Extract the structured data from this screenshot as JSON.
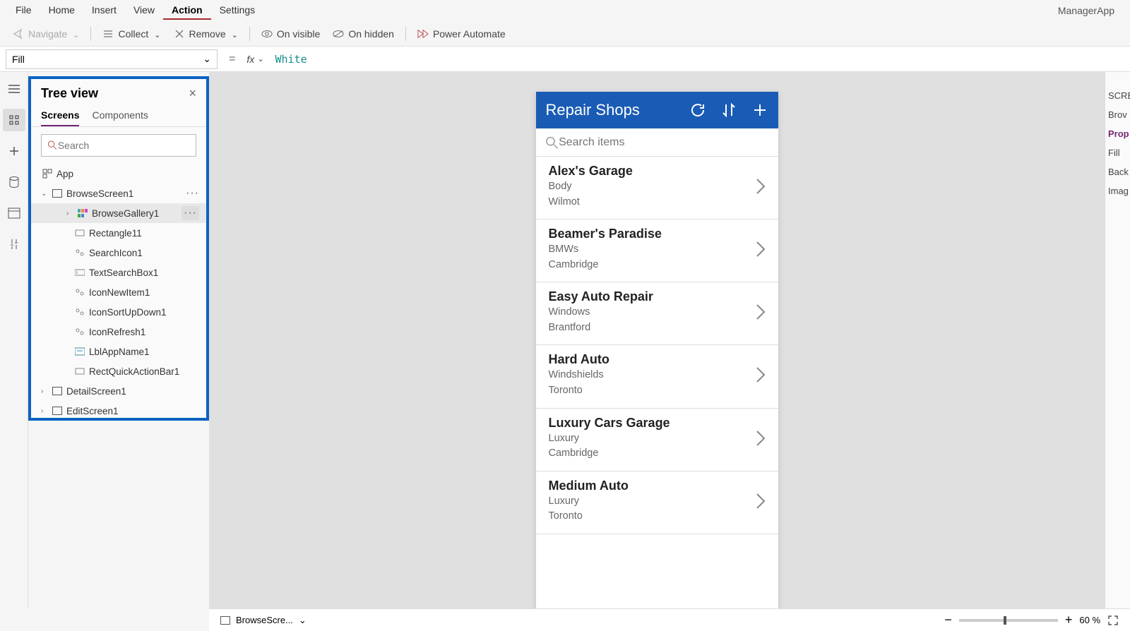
{
  "menubar": {
    "items": [
      "File",
      "Home",
      "Insert",
      "View",
      "Action",
      "Settings"
    ],
    "active": "Action",
    "app_name": "ManagerApp"
  },
  "toolbar": {
    "navigate": "Navigate",
    "collect": "Collect",
    "remove": "Remove",
    "on_visible": "On visible",
    "on_hidden": "On hidden",
    "power_automate": "Power Automate"
  },
  "formula": {
    "property": "Fill",
    "value": "White"
  },
  "tree": {
    "title": "Tree view",
    "tabs": [
      "Screens",
      "Components"
    ],
    "active_tab": "Screens",
    "search_placeholder": "Search",
    "app_node": "App",
    "nodes": [
      {
        "name": "BrowseScreen1",
        "expanded": true,
        "level": 1,
        "icon": "screen"
      },
      {
        "name": "BrowseGallery1",
        "expanded": false,
        "level": 2,
        "icon": "gallery",
        "hovered": true
      },
      {
        "name": "Rectangle11",
        "level": 3,
        "icon": "rect"
      },
      {
        "name": "SearchIcon1",
        "level": 3,
        "icon": "icon"
      },
      {
        "name": "TextSearchBox1",
        "level": 3,
        "icon": "textbox"
      },
      {
        "name": "IconNewItem1",
        "level": 3,
        "icon": "icon"
      },
      {
        "name": "IconSortUpDown1",
        "level": 3,
        "icon": "icon"
      },
      {
        "name": "IconRefresh1",
        "level": 3,
        "icon": "icon"
      },
      {
        "name": "LblAppName1",
        "level": 3,
        "icon": "label"
      },
      {
        "name": "RectQuickActionBar1",
        "level": 3,
        "icon": "rect"
      },
      {
        "name": "DetailScreen1",
        "expanded": false,
        "level": 1,
        "icon": "screen"
      },
      {
        "name": "EditScreen1",
        "expanded": false,
        "level": 1,
        "icon": "screen"
      }
    ]
  },
  "phone": {
    "title": "Repair Shops",
    "search_placeholder": "Search items",
    "items": [
      {
        "title": "Alex's Garage",
        "line1": "Body",
        "line2": "Wilmot"
      },
      {
        "title": "Beamer's Paradise",
        "line1": "BMWs",
        "line2": "Cambridge"
      },
      {
        "title": "Easy Auto Repair",
        "line1": "Windows",
        "line2": "Brantford"
      },
      {
        "title": "Hard Auto",
        "line1": "Windshields",
        "line2": "Toronto"
      },
      {
        "title": "Luxury Cars Garage",
        "line1": "Luxury",
        "line2": "Cambridge"
      },
      {
        "title": "Medium Auto",
        "line1": "Luxury",
        "line2": "Toronto"
      }
    ]
  },
  "right_panel": {
    "header": "SCRE",
    "name": "Brov",
    "tab": "Prop",
    "rows": [
      "Fill",
      "Back",
      "Imag"
    ]
  },
  "status": {
    "screen_dropdown": "BrowseScre...",
    "zoom": "60",
    "zoom_unit": "%"
  }
}
